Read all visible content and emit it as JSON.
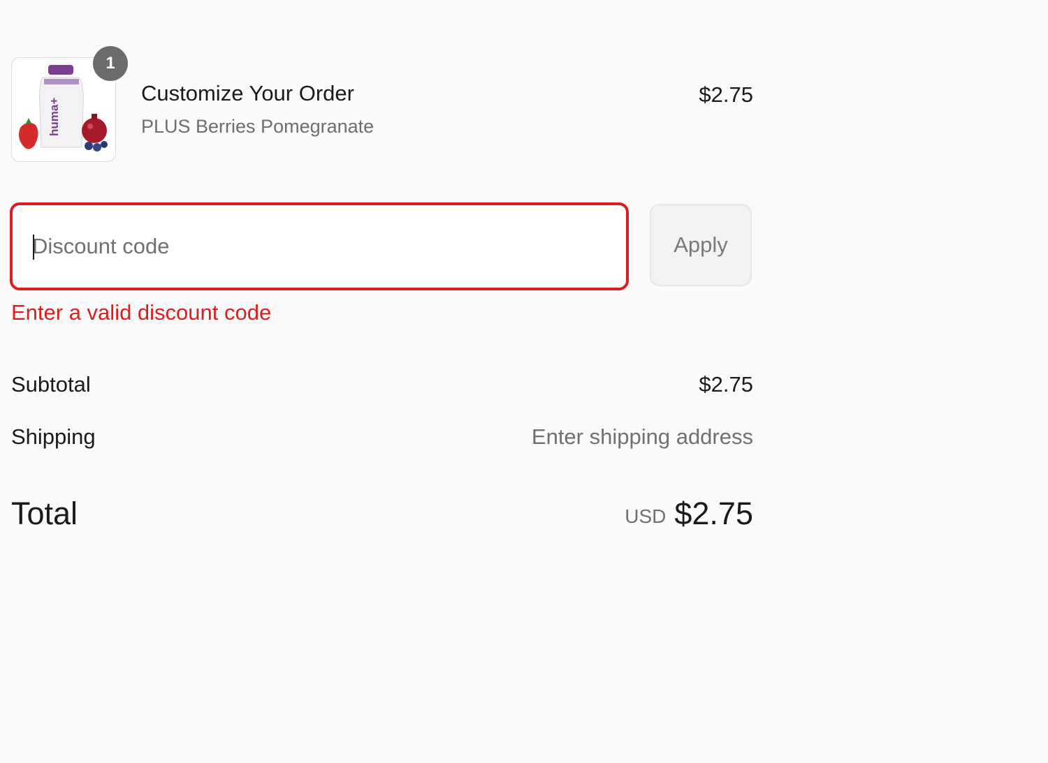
{
  "line_item": {
    "quantity": "1",
    "title": "Customize Your Order",
    "variant": "PLUS Berries Pomegranate",
    "price": "$2.75",
    "image_icon": "product-pouch-icon",
    "product_brand": "huma+"
  },
  "discount": {
    "placeholder": "Discount code",
    "value": "",
    "apply_label": "Apply",
    "error": "Enter a valid discount code"
  },
  "totals": {
    "subtotal_label": "Subtotal",
    "subtotal_value": "$2.75",
    "shipping_label": "Shipping",
    "shipping_value": "Enter shipping address",
    "total_label": "Total",
    "currency": "USD",
    "total_value": "$2.75"
  },
  "colors": {
    "error": "#dd1d1d",
    "badge": "#6b6b6b",
    "muted_text": "#707070",
    "background": "#fafafa"
  }
}
